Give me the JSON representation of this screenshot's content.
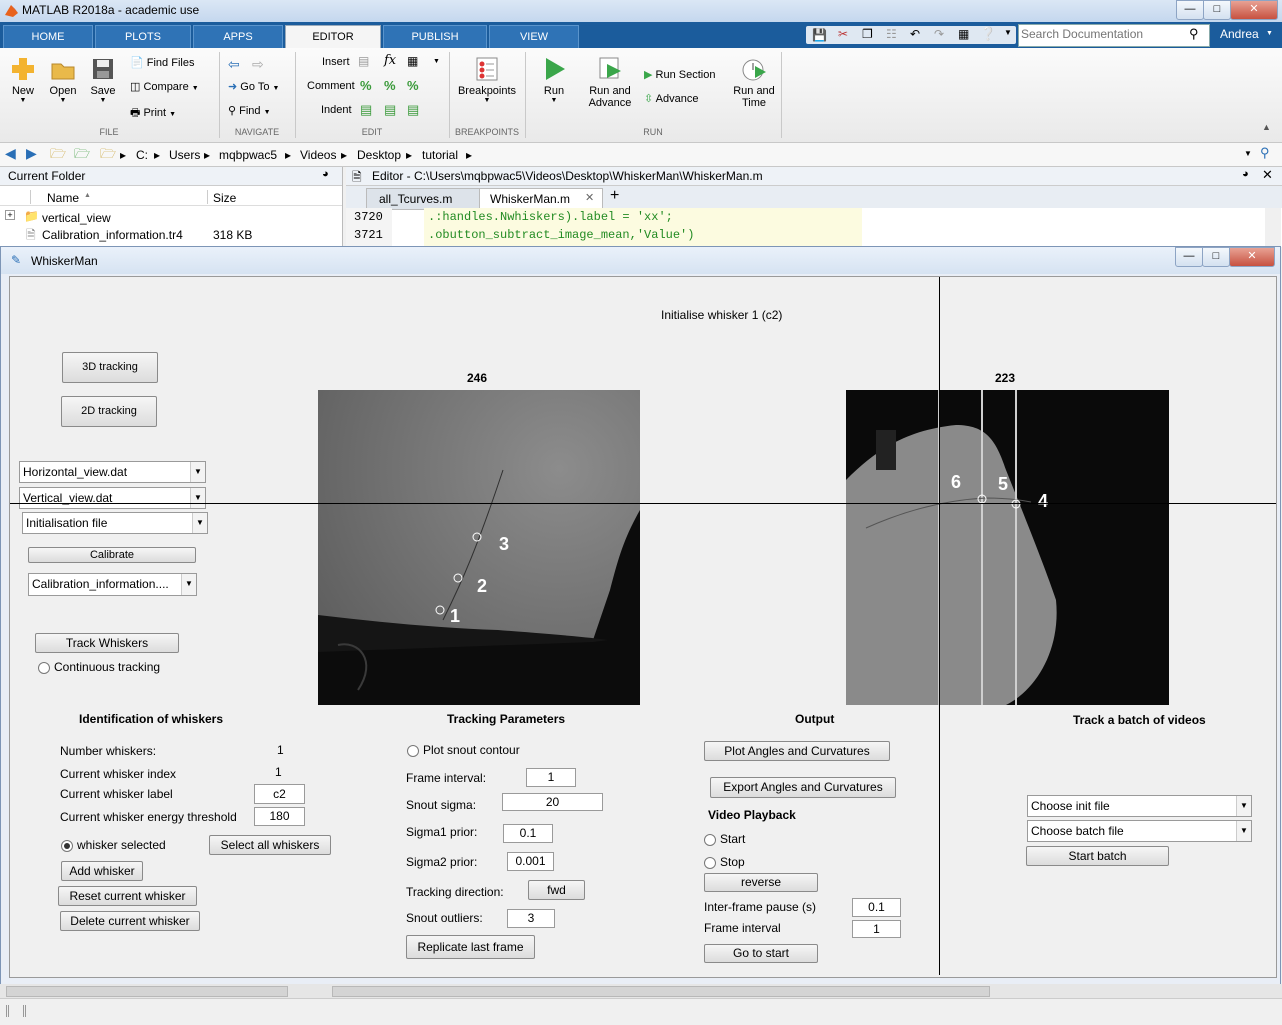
{
  "window": {
    "title": "MATLAB R2018a - academic use"
  },
  "tabs": [
    {
      "label": "HOME"
    },
    {
      "label": "PLOTS"
    },
    {
      "label": "APPS"
    },
    {
      "label": "EDITOR"
    },
    {
      "label": "PUBLISH"
    },
    {
      "label": "VIEW"
    }
  ],
  "search": {
    "placeholder": "Search Documentation"
  },
  "user": {
    "name": "Andrea"
  },
  "ribbon": {
    "new": "New",
    "open": "Open",
    "save": "Save",
    "find_files": "Find Files",
    "compare": "Compare",
    "print": "Print",
    "go_to": "Go To",
    "find": "Find",
    "insert": "Insert",
    "comment": "Comment",
    "indent": "Indent",
    "breakpoints": "Breakpoints",
    "run": "Run",
    "run_and_advance_1": "Run and",
    "run_and_advance_2": "Advance",
    "run_section": "Run Section",
    "advance": "Advance",
    "run_and_time_1": "Run and",
    "run_and_time_2": "Time",
    "sections": {
      "file": "FILE",
      "navigate": "NAVIGATE",
      "edit": "EDIT",
      "breakpoints": "BREAKPOINTS",
      "run": "RUN"
    }
  },
  "address": [
    "C:",
    "Users",
    "mqbpwac5",
    "Videos",
    "Desktop",
    "tutorial"
  ],
  "current_folder": {
    "title": "Current Folder",
    "col_name": "Name",
    "col_size": "Size",
    "files": [
      {
        "name": "vertical_view",
        "size": ""
      },
      {
        "name": "Calibration_information.tr4",
        "size": "318 KB"
      }
    ]
  },
  "editor": {
    "title": "Editor - C:\\Users\\mqbpwac5\\Videos\\Desktop\\WhiskerMan\\WhiskerMan.m",
    "tabs": [
      "all_Tcurves.m",
      "WhiskerMan.m"
    ],
    "lines": [
      {
        "num": "3720",
        "code": ".:handles.Nwhiskers).label = 'xx';"
      },
      {
        "num": "3721",
        "code": ".obutton_subtract_image_mean,'Value')"
      }
    ]
  },
  "figure": {
    "title": "WhiskerMan",
    "status": "Initialise whisker 1 (c2)",
    "left_frame_label": "246",
    "right_frame_label": "223",
    "markers_left": [
      "1",
      "2",
      "3"
    ],
    "markers_right": [
      "4",
      "5",
      "6"
    ],
    "buttons": {
      "tracking3d": "3D tracking",
      "tracking2d": "2D tracking",
      "calibrate": "Calibrate",
      "track_whiskers": "Track Whiskers",
      "select_all": "Select all whiskers",
      "add_whisker": "Add whisker",
      "reset_whisker": "Reset current whisker",
      "delete_whisker": "Delete current whisker",
      "fwd": "fwd",
      "replicate": "Replicate last frame",
      "plot_angles": "Plot Angles and Curvatures",
      "export_angles": "Export Angles and Curvatures",
      "reverse": "reverse",
      "go_to_start": "Go to start",
      "start_batch": "Start batch"
    },
    "selects": {
      "horizontal": "Horizontal_view.dat",
      "vertical": "Vertical_view.dat",
      "init_file": "Initialisation file",
      "calibration": "Calibration_information....",
      "choose_init": "Choose init file",
      "choose_batch": "Choose batch file"
    },
    "continuous_tracking": "Continuous tracking",
    "identification": {
      "title": "Identification of whiskers",
      "number_label": "Number whiskers:",
      "number_value": "1",
      "index_label": "Current whisker index",
      "index_value": "1",
      "label_label": "Current whisker label",
      "label_value": "c2",
      "energy_label": "Current whisker energy threshold",
      "energy_value": "180",
      "selected_label": "whisker selected"
    },
    "tracking": {
      "title": "Tracking Parameters",
      "plot_snout": "Plot snout contour",
      "frame_interval_label": "Frame interval:",
      "frame_interval_value": "1",
      "snout_sigma_label": "Snout sigma:",
      "snout_sigma_value": "20",
      "sigma1_label": "Sigma1 prior:",
      "sigma1_value": "0.1",
      "sigma2_label": "Sigma2 prior:",
      "sigma2_value": "0.001",
      "direction_label": "Tracking direction:",
      "outliers_label": "Snout outliers:",
      "outliers_value": "3"
    },
    "output": {
      "title": "Output",
      "video_playback": "Video Playback",
      "start": "Start",
      "stop": "Stop",
      "pause_label": "Inter-frame pause (s)",
      "pause_value": "0.1",
      "frame_interval_label": "Frame interval",
      "frame_interval_value": "1"
    },
    "batch": {
      "title": "Track a batch of videos"
    }
  },
  "colors": {
    "tab_bar": "#1b5c9c",
    "tab_active": "#f5f5f5",
    "code_green": "#228b22",
    "run_green": "#3aa64a"
  }
}
